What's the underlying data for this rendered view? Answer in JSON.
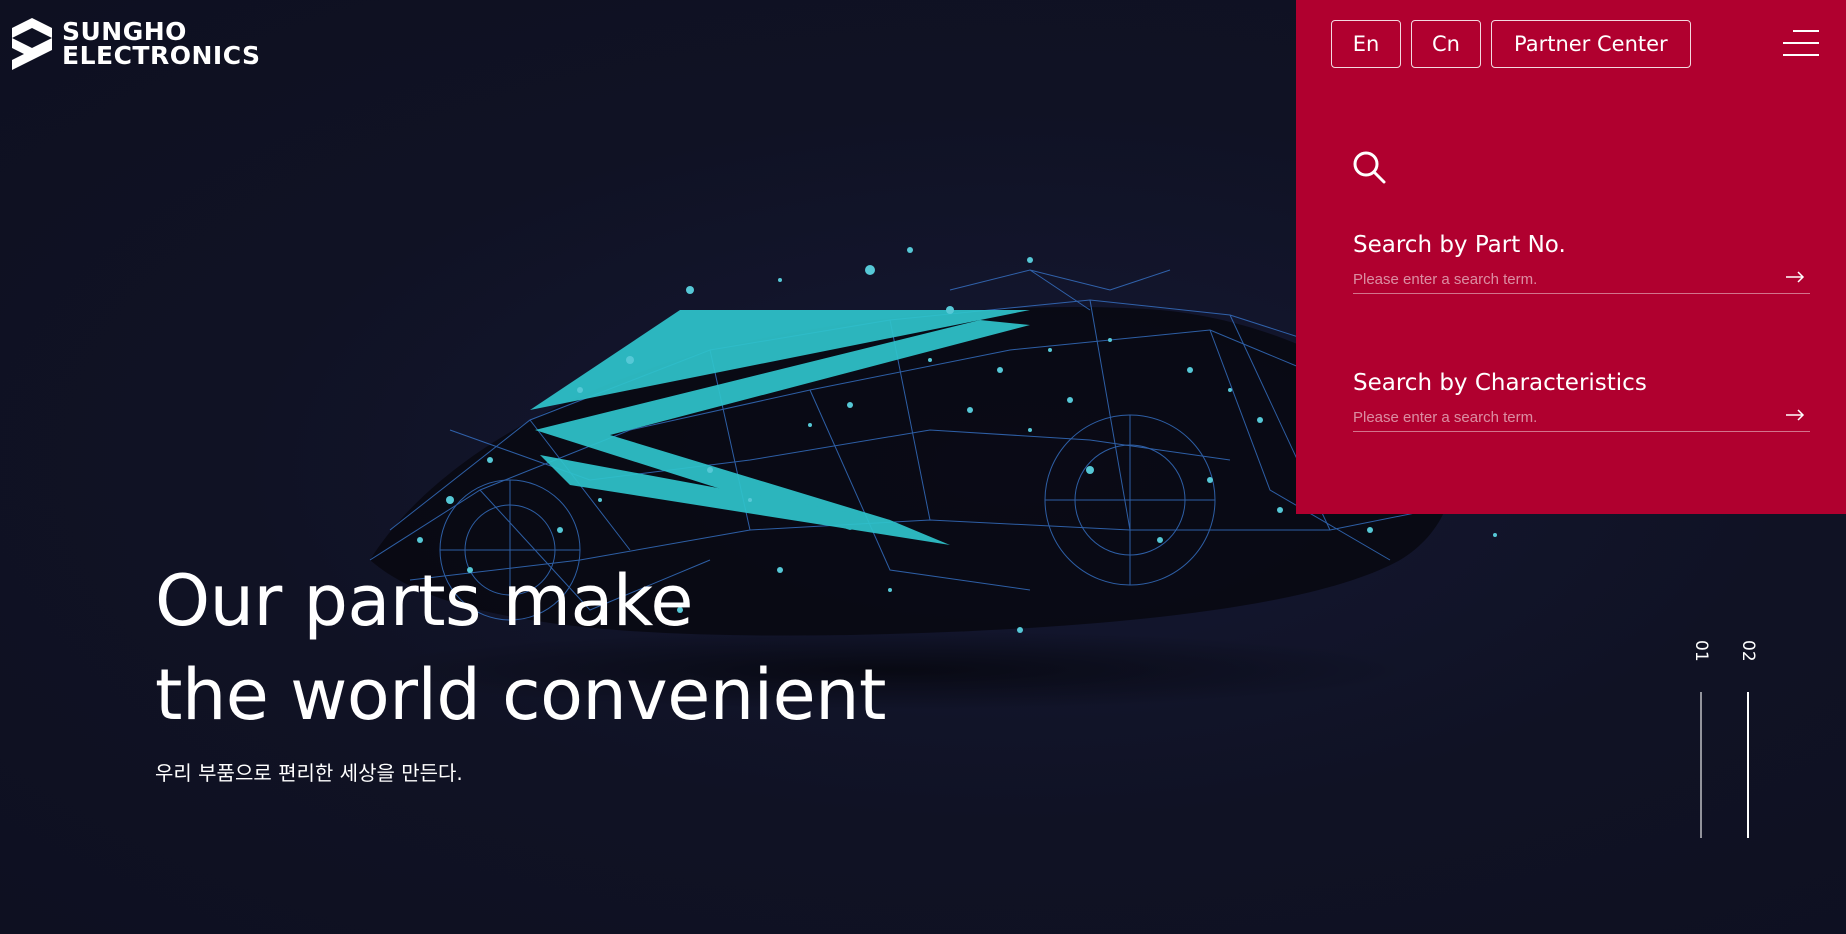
{
  "brand": {
    "line1": "SUNGHO",
    "line2": "ELECTRONICS"
  },
  "top_nav": {
    "lang_en": "En",
    "lang_cn": "Cn",
    "partner_center": "Partner Center"
  },
  "search": {
    "part_no": {
      "title": "Search by Part No.",
      "placeholder": "Please enter a search term."
    },
    "characteristics": {
      "title": "Search by Characteristics",
      "placeholder": "Please enter a search term."
    }
  },
  "hero": {
    "headline_line1": "Our parts make",
    "headline_line2": "the world convenient",
    "subtitle": "우리 부품으로 편리한 세상을 만든다."
  },
  "slides": {
    "items": [
      "01",
      "02"
    ],
    "active_index": 1
  },
  "colors": {
    "background": "#101224",
    "accent_panel": "#b0002f",
    "car_highlight": "#2fc4cc",
    "car_wire": "#3a7bd5"
  },
  "icons": {
    "search": "search-icon",
    "menu": "hamburger-menu-icon",
    "arrow": "arrow-right-icon"
  }
}
